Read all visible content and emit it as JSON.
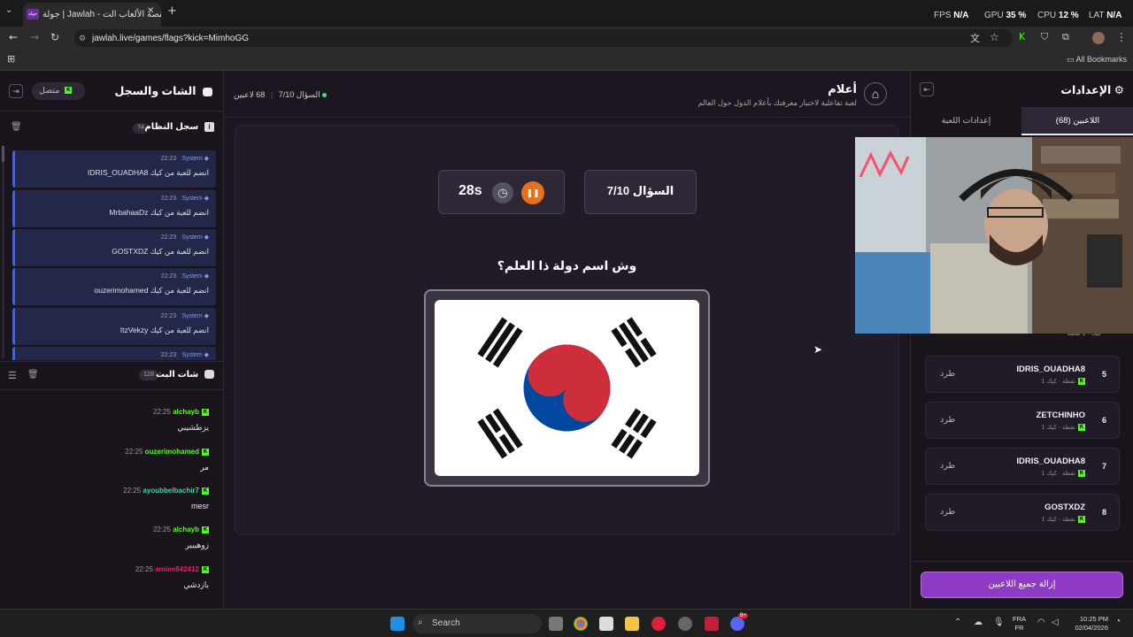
{
  "browser": {
    "tab_title": "جولة | Jawlah - منصة الألعاب الت...",
    "tab_icon_text": "جولة",
    "url": "jawlah.live/games/flags?kick=MimhoGG",
    "bookmarks_label": "All Bookmarks"
  },
  "overlay_stats": {
    "fps_label": "FPS",
    "fps_value": "N/A",
    "gpu_label": "GPU",
    "gpu_value": "35",
    "cpu_label": "CPU",
    "cpu_value": "12",
    "lat_label": "LAT",
    "lat_value": "N/A"
  },
  "left_panel": {
    "title": "الشات والسجل",
    "status_label": "متصل",
    "system_log": {
      "title": "سجل النظام",
      "count": "74",
      "messages": [
        {
          "sender": "System",
          "time": "22:23",
          "text": "IDRIS_OUADHA8 انضم للعبة من كيك"
        },
        {
          "sender": "System",
          "time": "22:23",
          "text": "MrbahaaDz انضم للعبة من كيك"
        },
        {
          "sender": "System",
          "time": "22:23",
          "text": "GOSTXDZ انضم للعبة من كيك"
        },
        {
          "sender": "System",
          "time": "22:23",
          "text": "ouzerimohamed انضم للعبة من كيك"
        },
        {
          "sender": "System",
          "time": "22:23",
          "text": "ItzVekzy انضم للعبة من كيك"
        },
        {
          "sender": "System",
          "time": "22:23",
          "text": ""
        }
      ]
    },
    "stream_chat": {
      "title": "شات البث",
      "count": "128",
      "messages": [
        {
          "user": "alchayb",
          "time": "22:25",
          "text": "يزطشيبي",
          "color": "#53fc18"
        },
        {
          "user": "ouzerimohamed",
          "time": "22:25",
          "text": "مر",
          "color": "#53fc18"
        },
        {
          "user": "ayoubbelbachir7",
          "time": "22:25",
          "text": "mesr",
          "color": "#3cd6a8"
        },
        {
          "user": "alchayb",
          "time": "22:25",
          "text": "زوهيبير",
          "color": "#53fc18"
        },
        {
          "user": "amine842412",
          "time": "22:25",
          "text": "بازدشي",
          "color": "#e0245e"
        }
      ]
    }
  },
  "game": {
    "title": "أعلام",
    "subtitle": "لعبة تفاعلية لاختبار معرفتك بأعلام الدول حول العالم",
    "players_count": "68 لاعبين",
    "question_short": "السؤال 7/10",
    "timer": "28s",
    "question_label": "السؤال 7/10",
    "question_text": "وش اسم دولة ذا العلم؟",
    "flag": "south-korea-flag"
  },
  "right_panel": {
    "title": "الإعدادات",
    "tabs": [
      {
        "label": "اللاعبين (68)",
        "active": true
      },
      {
        "label": "إعدادات اللعبة",
        "active": false
      }
    ],
    "partial_player_sub": "كيك · 1 نقطة",
    "players": [
      {
        "rank": "5",
        "name": "IDRIS_OUADHA8",
        "platform": "كيك",
        "points": "1 نقطة",
        "kick_label": "طرد"
      },
      {
        "rank": "6",
        "name": "ZETCHINHO",
        "platform": "كيك",
        "points": "1 نقطة",
        "kick_label": "طرد"
      },
      {
        "rank": "7",
        "name": "IDRIS_OUADHA8",
        "platform": "كيك",
        "points": "1 نقطة",
        "kick_label": "طرد"
      },
      {
        "rank": "8",
        "name": "GOSTXDZ",
        "platform": "كيك",
        "points": "1 نقطة",
        "kick_label": "طرد"
      }
    ],
    "remove_all_label": "إزالة جميع اللاعبين"
  },
  "taskbar": {
    "search_placeholder": "Search",
    "lang_1": "FRA",
    "lang_2": "FR",
    "time": "10:25 PM",
    "date": "02/04/2026",
    "discord_badge": "9+"
  },
  "colors": {
    "accent_purple": "#9b3fd1",
    "pause_orange": "#e8701a",
    "kick_green": "#53fc18",
    "system_blue": "#4a63c9"
  }
}
